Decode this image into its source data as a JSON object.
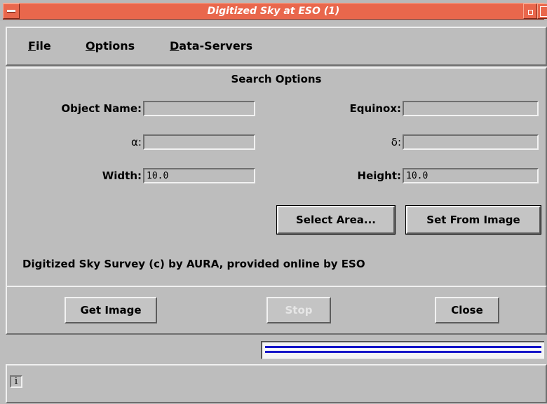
{
  "window": {
    "title": "Digitized Sky at ESO (1)",
    "title_bar_color": "#e9674c"
  },
  "menu": {
    "file": {
      "label": "File",
      "mnemonic": "F",
      "rest": "ile"
    },
    "options": {
      "label": "Options",
      "mnemonic": "O",
      "rest": "ptions"
    },
    "data_servers": {
      "label": "Data-Servers",
      "mnemonic": "D",
      "rest": "ata-Servers"
    }
  },
  "search": {
    "section_title": "Search Options",
    "object_name": {
      "label": "Object Name:",
      "value": ""
    },
    "equinox": {
      "label": "Equinox:",
      "value": ""
    },
    "alpha": {
      "label": "α:",
      "value": ""
    },
    "delta": {
      "label": "δ:",
      "value": ""
    },
    "width": {
      "label": "Width:",
      "value": "10.0"
    },
    "height": {
      "label": "Height:",
      "value": "10.0"
    },
    "select_area_label": "Select Area...",
    "set_from_image_label": "Set From Image"
  },
  "notice": "Digitized Sky Survey (c) by AURA, provided online by ESO",
  "actions": {
    "get_image_label": "Get Image",
    "stop_label": "Stop",
    "close_label": "Close"
  },
  "progress": {
    "fraction": 1.0
  },
  "status": {
    "icon": "info-icon",
    "icon_glyph": "i",
    "message": ""
  }
}
